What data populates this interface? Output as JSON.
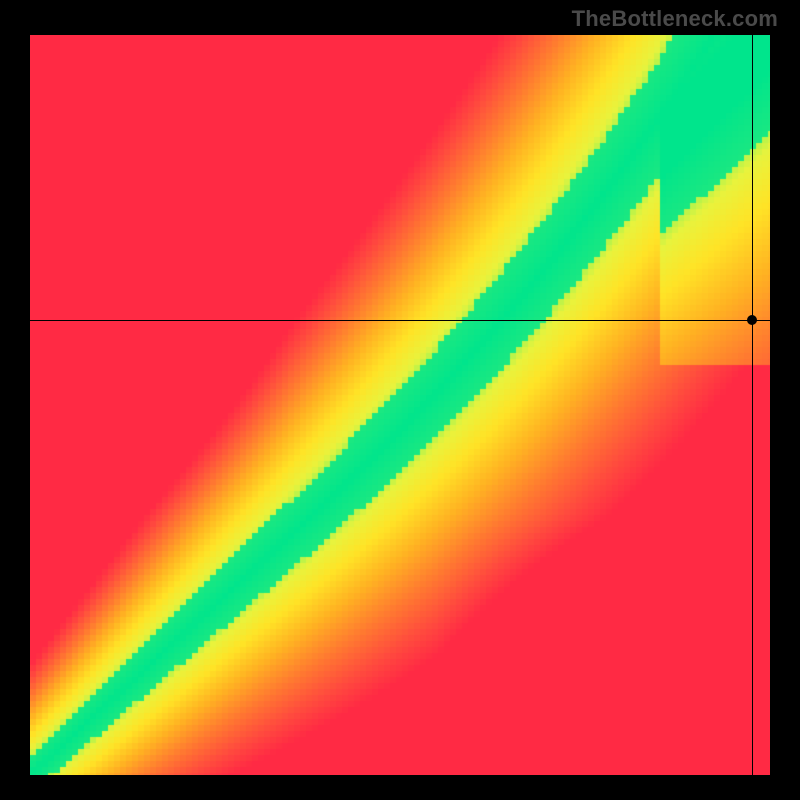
{
  "attribution": "TheBottleneck.com",
  "chart_data": {
    "type": "heatmap",
    "title": "",
    "xlabel": "",
    "ylabel": "",
    "xlim": [
      0,
      100
    ],
    "ylim": [
      0,
      100
    ],
    "legend": "none",
    "grid": false,
    "description": "Square heatmap with a diagonal green optimality band curving from the bottom-left to the upper-right. Colors transition from green (ideal match) outward through yellow to orange and red (mismatch). Crosshair lines intersect at a marker dot near the top-right.",
    "colorStops": [
      {
        "t": 0.0,
        "color": "#00e58c"
      },
      {
        "t": 0.14,
        "color": "#7bf25a"
      },
      {
        "t": 0.24,
        "color": "#e8f33d"
      },
      {
        "t": 0.38,
        "color": "#ffe326"
      },
      {
        "t": 0.55,
        "color": "#ffb222"
      },
      {
        "t": 0.72,
        "color": "#ff7a30"
      },
      {
        "t": 0.88,
        "color": "#ff4a3e"
      },
      {
        "t": 1.0,
        "color": "#ff2a44"
      }
    ],
    "bandHalfWidth": 0.055,
    "pixelation": 6,
    "upperRightGreenExtend": 0.045,
    "marker": {
      "x": 97.5,
      "y": 61.5
    },
    "crosshair": {
      "x": 97.5,
      "y": 61.5
    }
  }
}
